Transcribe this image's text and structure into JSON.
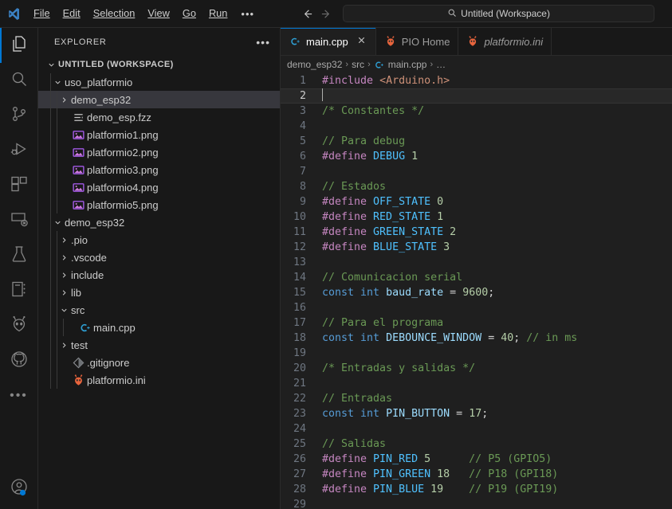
{
  "titlebar": {
    "logo_icon": "vscode-logo-icon",
    "menus": [
      "File",
      "Edit",
      "Selection",
      "View",
      "Go",
      "Run"
    ],
    "more_label": "•••",
    "back_icon": "arrow-left-icon",
    "forward_icon": "arrow-right-icon",
    "command_center": {
      "icon": "search-icon",
      "text": "Untitled (Workspace)"
    }
  },
  "activitybar": {
    "top_items": [
      {
        "name": "explorer",
        "icon": "files-icon",
        "active": true
      },
      {
        "name": "search",
        "icon": "search-icon",
        "active": false
      },
      {
        "name": "source-control",
        "icon": "source-control-icon",
        "active": false
      },
      {
        "name": "run-and-debug",
        "icon": "run-debug-icon",
        "active": false
      },
      {
        "name": "extensions",
        "icon": "extensions-icon",
        "active": false
      },
      {
        "name": "remote-explorer",
        "icon": "remote-explorer-icon",
        "active": false
      },
      {
        "name": "testing",
        "icon": "beaker-icon",
        "active": false
      },
      {
        "name": "notebook",
        "icon": "notebook-icon",
        "active": false
      },
      {
        "name": "platformio",
        "icon": "platformio-alien-icon",
        "active": false
      },
      {
        "name": "github",
        "icon": "github-icon",
        "active": false
      },
      {
        "name": "more-views",
        "icon": "ellipsis-icon",
        "active": false
      }
    ],
    "bottom_items": [
      {
        "name": "accounts",
        "icon": "account-icon",
        "active": false
      }
    ]
  },
  "sidebar": {
    "title": "EXPLORER",
    "actions_icon": "ellipsis-icon",
    "tree": [
      {
        "label": "UNTITLED (WORKSPACE)",
        "depth": 0,
        "kind": "root",
        "twisty": "down",
        "icon": "none",
        "selected": false
      },
      {
        "label": "uso_platformio",
        "depth": 1,
        "kind": "folder",
        "twisty": "down",
        "icon": "none",
        "selected": false
      },
      {
        "label": "demo_esp32",
        "depth": 2,
        "kind": "folder",
        "twisty": "right",
        "icon": "none",
        "selected": true
      },
      {
        "label": "demo_esp.fzz",
        "depth": 2,
        "kind": "file",
        "twisty": "none",
        "icon": "fritzing-icon",
        "selected": false
      },
      {
        "label": "platformio1.png",
        "depth": 2,
        "kind": "file",
        "twisty": "none",
        "icon": "image-icon",
        "selected": false
      },
      {
        "label": "platformio2.png",
        "depth": 2,
        "kind": "file",
        "twisty": "none",
        "icon": "image-icon",
        "selected": false
      },
      {
        "label": "platformio3.png",
        "depth": 2,
        "kind": "file",
        "twisty": "none",
        "icon": "image-icon",
        "selected": false
      },
      {
        "label": "platformio4.png",
        "depth": 2,
        "kind": "file",
        "twisty": "none",
        "icon": "image-icon",
        "selected": false
      },
      {
        "label": "platformio5.png",
        "depth": 2,
        "kind": "file",
        "twisty": "none",
        "icon": "image-icon",
        "selected": false
      },
      {
        "label": "demo_esp32",
        "depth": 1,
        "kind": "folder",
        "twisty": "down",
        "icon": "none",
        "selected": false
      },
      {
        "label": ".pio",
        "depth": 2,
        "kind": "folder",
        "twisty": "right",
        "icon": "none",
        "selected": false
      },
      {
        "label": ".vscode",
        "depth": 2,
        "kind": "folder",
        "twisty": "right",
        "icon": "none",
        "selected": false
      },
      {
        "label": "include",
        "depth": 2,
        "kind": "folder",
        "twisty": "right",
        "icon": "none",
        "selected": false
      },
      {
        "label": "lib",
        "depth": 2,
        "kind": "folder",
        "twisty": "right",
        "icon": "none",
        "selected": false
      },
      {
        "label": "src",
        "depth": 2,
        "kind": "folder",
        "twisty": "down",
        "icon": "none",
        "selected": false
      },
      {
        "label": "main.cpp",
        "depth": 3,
        "kind": "file",
        "twisty": "none",
        "icon": "cpp-icon",
        "selected": false
      },
      {
        "label": "test",
        "depth": 2,
        "kind": "folder",
        "twisty": "right",
        "icon": "none",
        "selected": false
      },
      {
        "label": ".gitignore",
        "depth": 2,
        "kind": "file",
        "twisty": "none",
        "icon": "git-icon",
        "selected": false
      },
      {
        "label": "platformio.ini",
        "depth": 2,
        "kind": "file",
        "twisty": "none",
        "icon": "platformio-icon",
        "selected": false
      }
    ]
  },
  "editor": {
    "tabs": [
      {
        "label": "main.cpp",
        "icon": "cpp-icon",
        "active": true,
        "preview": false,
        "close_icon": "close-icon",
        "has_close": true
      },
      {
        "label": "PIO Home",
        "icon": "platformio-icon",
        "active": false,
        "preview": false,
        "has_close": false
      },
      {
        "label": "platformio.ini",
        "icon": "platformio-icon",
        "active": false,
        "preview": true,
        "has_close": false
      }
    ],
    "breadcrumb": [
      {
        "text": "demo_esp32",
        "icon": "none"
      },
      {
        "text": "src",
        "icon": "none"
      },
      {
        "text": "main.cpp",
        "icon": "cpp-icon"
      },
      {
        "text": "…",
        "icon": "none"
      }
    ],
    "active_line": 2,
    "lines": [
      {
        "n": 1,
        "tokens": [
          {
            "t": "#include ",
            "c": "t-pre"
          },
          {
            "t": "<Arduino.h>",
            "c": "t-str"
          }
        ]
      },
      {
        "n": 2,
        "tokens": [],
        "cursor": true
      },
      {
        "n": 3,
        "tokens": [
          {
            "t": "/* Constantes */",
            "c": "t-cmt"
          }
        ]
      },
      {
        "n": 4,
        "tokens": []
      },
      {
        "n": 5,
        "tokens": [
          {
            "t": "// Para debug",
            "c": "t-cmt"
          }
        ]
      },
      {
        "n": 6,
        "tokens": [
          {
            "t": "#define ",
            "c": "t-pre"
          },
          {
            "t": "DEBUG",
            "c": "t-macro"
          },
          {
            "t": " ",
            "c": "t-op"
          },
          {
            "t": "1",
            "c": "t-num"
          }
        ]
      },
      {
        "n": 7,
        "tokens": []
      },
      {
        "n": 8,
        "tokens": [
          {
            "t": "// Estados",
            "c": "t-cmt"
          }
        ]
      },
      {
        "n": 9,
        "tokens": [
          {
            "t": "#define ",
            "c": "t-pre"
          },
          {
            "t": "OFF_STATE",
            "c": "t-macro"
          },
          {
            "t": " ",
            "c": "t-op"
          },
          {
            "t": "0",
            "c": "t-num"
          }
        ]
      },
      {
        "n": 10,
        "tokens": [
          {
            "t": "#define ",
            "c": "t-pre"
          },
          {
            "t": "RED_STATE",
            "c": "t-macro"
          },
          {
            "t": " ",
            "c": "t-op"
          },
          {
            "t": "1",
            "c": "t-num"
          }
        ]
      },
      {
        "n": 11,
        "tokens": [
          {
            "t": "#define ",
            "c": "t-pre"
          },
          {
            "t": "GREEN_STATE",
            "c": "t-macro"
          },
          {
            "t": " ",
            "c": "t-op"
          },
          {
            "t": "2",
            "c": "t-num"
          }
        ]
      },
      {
        "n": 12,
        "tokens": [
          {
            "t": "#define ",
            "c": "t-pre"
          },
          {
            "t": "BLUE_STATE",
            "c": "t-macro"
          },
          {
            "t": " ",
            "c": "t-op"
          },
          {
            "t": "3",
            "c": "t-num"
          }
        ]
      },
      {
        "n": 13,
        "tokens": []
      },
      {
        "n": 14,
        "tokens": [
          {
            "t": "// Comunicacion serial",
            "c": "t-cmt"
          }
        ]
      },
      {
        "n": 15,
        "tokens": [
          {
            "t": "const",
            "c": "t-kw"
          },
          {
            "t": " ",
            "c": "t-op"
          },
          {
            "t": "int",
            "c": "t-kw"
          },
          {
            "t": " ",
            "c": "t-op"
          },
          {
            "t": "baud_rate",
            "c": "t-var"
          },
          {
            "t": " = ",
            "c": "t-op"
          },
          {
            "t": "9600",
            "c": "t-num"
          },
          {
            "t": ";",
            "c": "t-op"
          }
        ]
      },
      {
        "n": 16,
        "tokens": []
      },
      {
        "n": 17,
        "tokens": [
          {
            "t": "// Para el programa",
            "c": "t-cmt"
          }
        ]
      },
      {
        "n": 18,
        "tokens": [
          {
            "t": "const",
            "c": "t-kw"
          },
          {
            "t": " ",
            "c": "t-op"
          },
          {
            "t": "int",
            "c": "t-kw"
          },
          {
            "t": " ",
            "c": "t-op"
          },
          {
            "t": "DEBOUNCE_WINDOW",
            "c": "t-var"
          },
          {
            "t": " = ",
            "c": "t-op"
          },
          {
            "t": "40",
            "c": "t-num"
          },
          {
            "t": "; ",
            "c": "t-op"
          },
          {
            "t": "// in ms",
            "c": "t-cmt"
          }
        ]
      },
      {
        "n": 19,
        "tokens": []
      },
      {
        "n": 20,
        "tokens": [
          {
            "t": "/* Entradas y salidas */",
            "c": "t-cmt"
          }
        ]
      },
      {
        "n": 21,
        "tokens": []
      },
      {
        "n": 22,
        "tokens": [
          {
            "t": "// Entradas",
            "c": "t-cmt"
          }
        ]
      },
      {
        "n": 23,
        "tokens": [
          {
            "t": "const",
            "c": "t-kw"
          },
          {
            "t": " ",
            "c": "t-op"
          },
          {
            "t": "int",
            "c": "t-kw"
          },
          {
            "t": " ",
            "c": "t-op"
          },
          {
            "t": "PIN_BUTTON",
            "c": "t-var"
          },
          {
            "t": " = ",
            "c": "t-op"
          },
          {
            "t": "17",
            "c": "t-num"
          },
          {
            "t": ";",
            "c": "t-op"
          }
        ]
      },
      {
        "n": 24,
        "tokens": []
      },
      {
        "n": 25,
        "tokens": [
          {
            "t": "// Salidas",
            "c": "t-cmt"
          }
        ]
      },
      {
        "n": 26,
        "tokens": [
          {
            "t": "#define ",
            "c": "t-pre"
          },
          {
            "t": "PIN_RED",
            "c": "t-macro"
          },
          {
            "t": " ",
            "c": "t-op"
          },
          {
            "t": "5",
            "c": "t-num"
          },
          {
            "t": "      ",
            "c": "t-op"
          },
          {
            "t": "// P5 (GPIO5)",
            "c": "t-cmt"
          }
        ]
      },
      {
        "n": 27,
        "tokens": [
          {
            "t": "#define ",
            "c": "t-pre"
          },
          {
            "t": "PIN_GREEN",
            "c": "t-macro"
          },
          {
            "t": " ",
            "c": "t-op"
          },
          {
            "t": "18",
            "c": "t-num"
          },
          {
            "t": "   ",
            "c": "t-op"
          },
          {
            "t": "// P18 (GPI18)",
            "c": "t-cmt"
          }
        ]
      },
      {
        "n": 28,
        "tokens": [
          {
            "t": "#define ",
            "c": "t-pre"
          },
          {
            "t": "PIN_BLUE",
            "c": "t-macro"
          },
          {
            "t": " ",
            "c": "t-op"
          },
          {
            "t": "19",
            "c": "t-num"
          },
          {
            "t": "    ",
            "c": "t-op"
          },
          {
            "t": "// P19 (GPI19)",
            "c": "t-cmt"
          }
        ]
      },
      {
        "n": 29,
        "tokens": []
      }
    ]
  },
  "colors": {
    "accent": "#0078d4",
    "editor_bg": "#1f1f1f",
    "chrome_bg": "#181818",
    "selected_row": "#37373d",
    "platformio_orange": "#e8643c",
    "cpp_blue": "#2e9fd4"
  }
}
